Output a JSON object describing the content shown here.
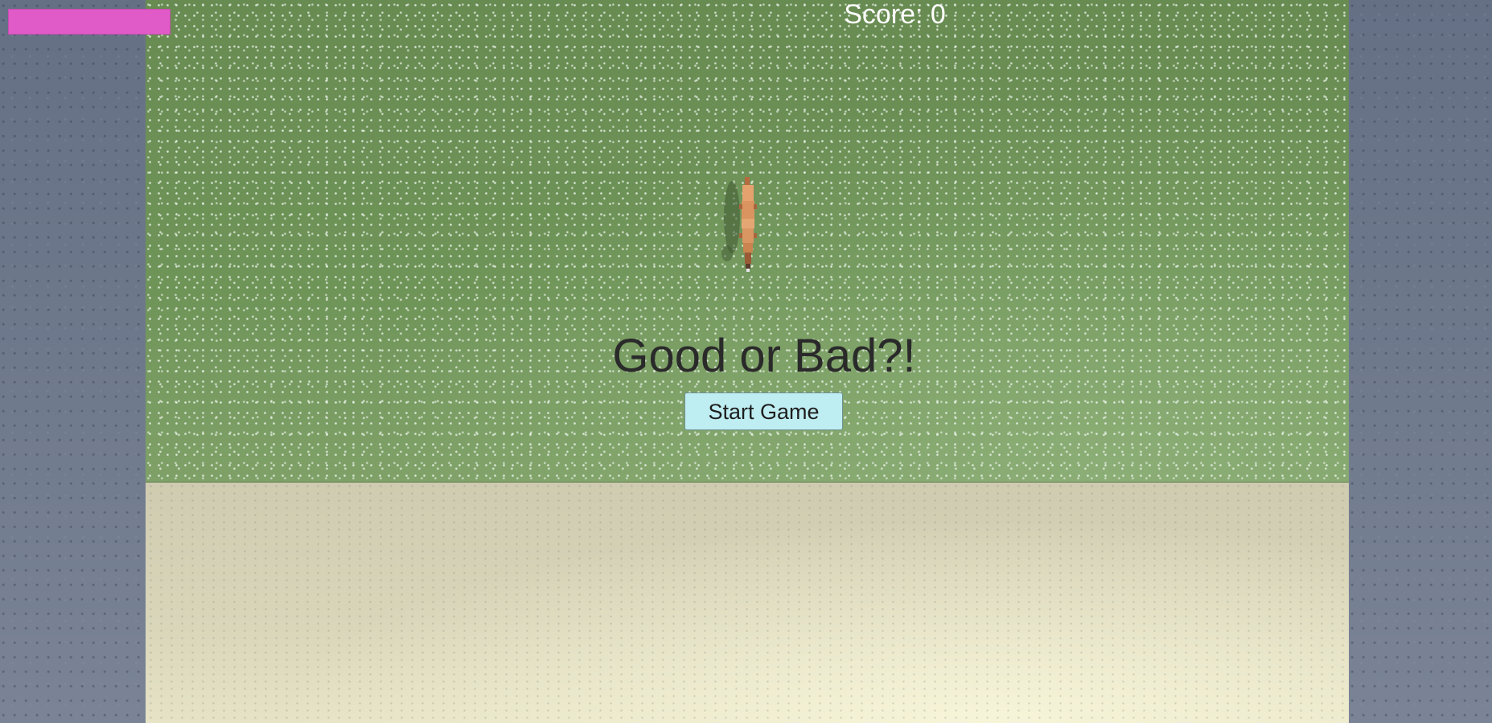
{
  "hud": {
    "score_label": "Score: 0",
    "health_fraction": 1.0,
    "health_color": "#e15bc8"
  },
  "menu": {
    "title": "Good or Bad?!",
    "start_label": "Start Game",
    "start_button_color": "#bfeef2"
  },
  "scene": {
    "grass_color": "#6f9258",
    "sand_color": "#d8d4b6",
    "wall_color": "#6b7588",
    "character_icon": "fox-icon"
  }
}
